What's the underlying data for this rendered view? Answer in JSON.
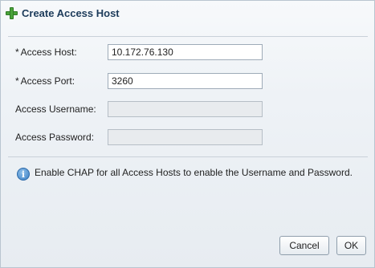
{
  "dialog": {
    "title": "Create Access Host",
    "icon": "plus-icon"
  },
  "form": {
    "required_marker": "*",
    "access_host": {
      "label": "Access Host:",
      "value": "10.172.76.130",
      "required": true
    },
    "access_port": {
      "label": "Access Port:",
      "value": "3260",
      "required": true
    },
    "access_username": {
      "label": "Access Username:",
      "value": "",
      "disabled": true
    },
    "access_password": {
      "label": "Access Password:",
      "value": "",
      "disabled": true
    }
  },
  "info": {
    "icon": "info-icon",
    "text": "Enable CHAP for all Access Hosts to enable the Username and Password."
  },
  "buttons": {
    "cancel_label": "Cancel",
    "ok_label": "OK"
  },
  "colors": {
    "title": "#1c3b5a",
    "plus_icon": "#4aa33a",
    "info_icon": "#3a7ec4"
  }
}
